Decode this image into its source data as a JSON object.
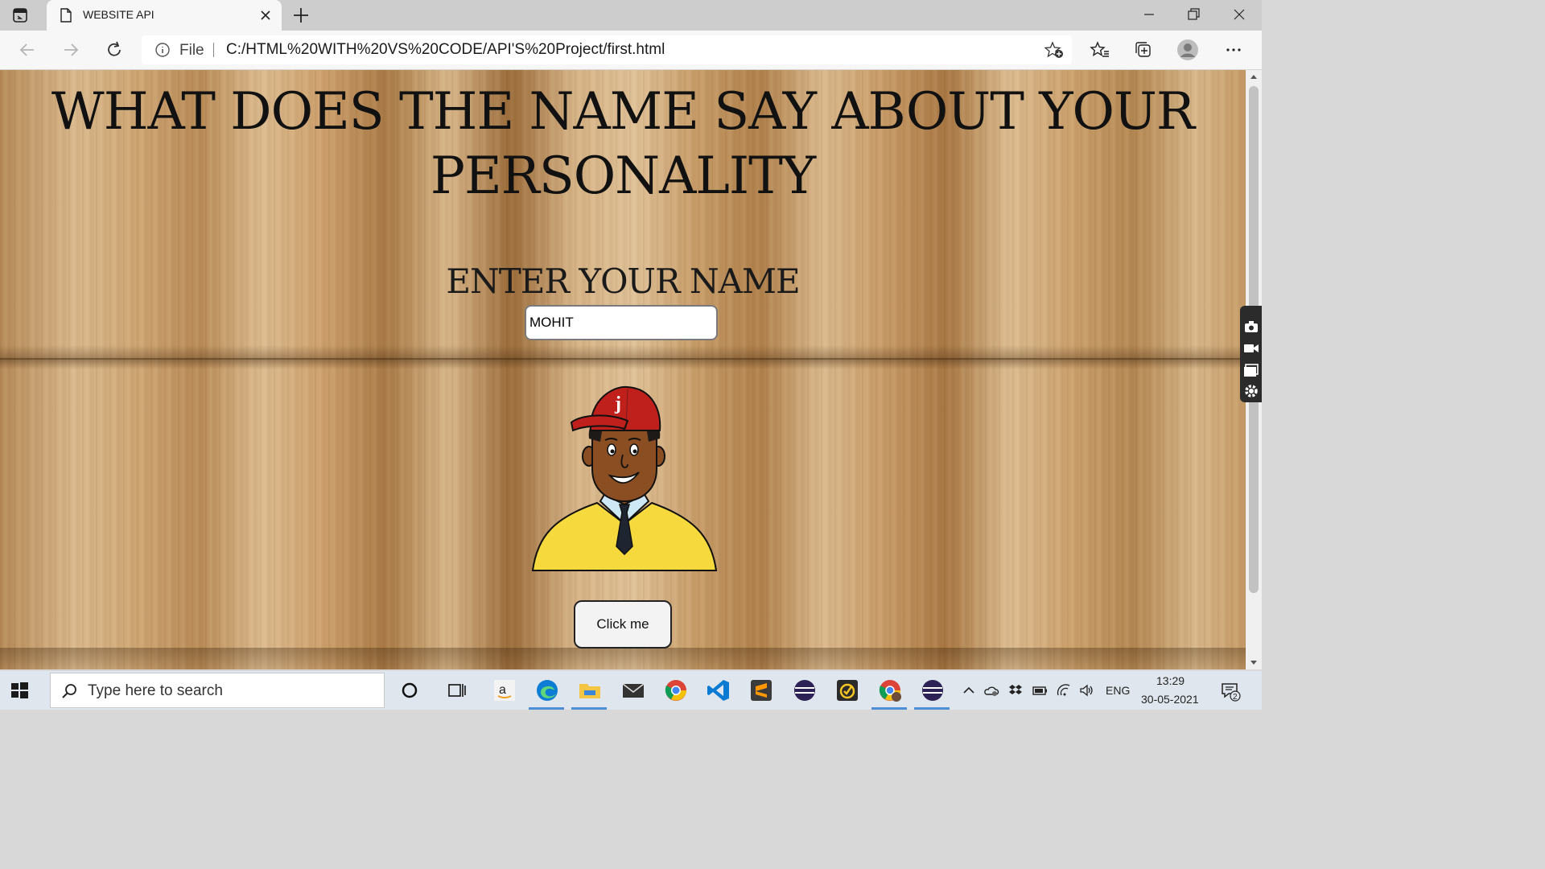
{
  "browser": {
    "tab_title": "WEBSITE API",
    "address": {
      "scheme_label": "File",
      "url": "C:/HTML%20WITH%20VS%20CODE/API'S%20Project/first.html"
    }
  },
  "page": {
    "headline": "WHAT DOES THE NAME SAY ABOUT YOUR PERSONALITY",
    "prompt_label": "ENTER YOUR NAME",
    "name_input_value": "MOHIT",
    "button_label": "Click me",
    "avatar_cap_letter": "j"
  },
  "taskbar": {
    "search_placeholder": "Type here to search",
    "language": "ENG",
    "time": "13:29",
    "date": "30-05-2021",
    "notification_count": "2",
    "apps": [
      "cortana-icon",
      "task-view-icon",
      "amazon-icon",
      "edge-icon",
      "file-explorer-icon",
      "mail-icon",
      "chrome-icon",
      "vscode-icon",
      "sublime-icon",
      "eclipse-icon",
      "todo-icon",
      "chrome-profile-icon",
      "eclipse-alt-icon"
    ]
  },
  "colors": {
    "wood_light": "#dcbb8f",
    "wood_dark": "#9c6c3a",
    "edge_accent": "#0c7cd5",
    "cap_red": "#c0201c",
    "sweater_yellow": "#f6d93d"
  }
}
